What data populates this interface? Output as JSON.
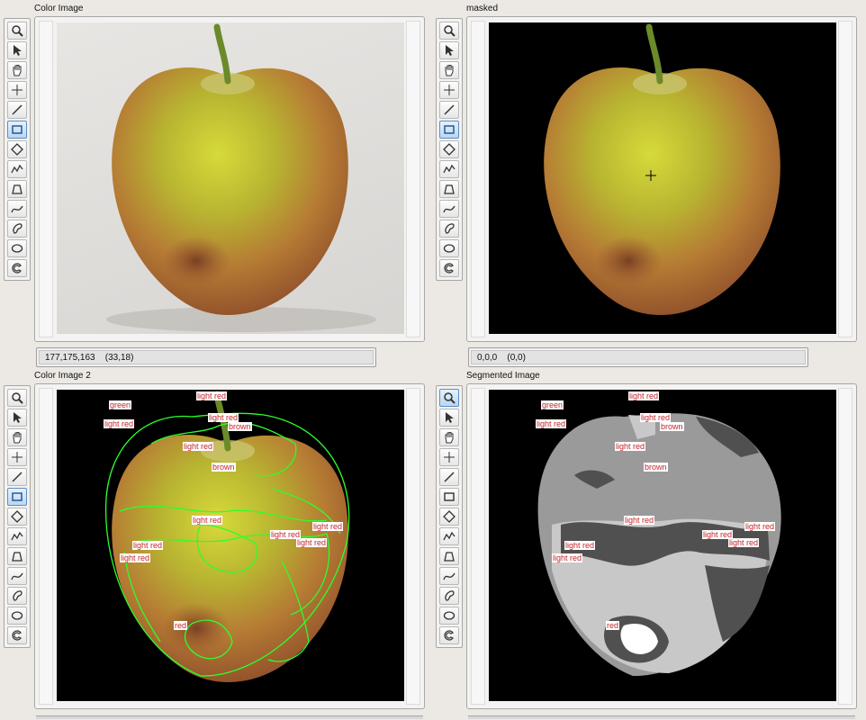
{
  "panels": {
    "top_left": {
      "title": "Color Image",
      "status_value": "177,175,163",
      "status_coord": "(33,18)"
    },
    "top_right": {
      "title": "masked",
      "status_value": "0,0,0",
      "status_coord": "(0,0)"
    },
    "bottom_left": {
      "title": "Color Image 2"
    },
    "bottom_right": {
      "title": "Segmented Image"
    }
  },
  "toolbar": {
    "tools": [
      "zoom-icon",
      "pointer-icon",
      "pan-hand-icon",
      "crosshair-icon",
      "line-icon",
      "rectangle-icon",
      "rotated-rect-icon",
      "polyline-icon",
      "annulus-icon",
      "freehand-icon",
      "closed-freehand-icon",
      "oval-icon",
      "broken-annulus-icon"
    ]
  },
  "labels": [
    {
      "text": "green"
    },
    {
      "text": "light red"
    },
    {
      "text": "light red"
    },
    {
      "text": "light red"
    },
    {
      "text": "brown"
    },
    {
      "text": "light red"
    },
    {
      "text": "brown"
    },
    {
      "text": "light red"
    },
    {
      "text": "light red"
    },
    {
      "text": "light red"
    },
    {
      "text": "light red"
    },
    {
      "text": "light red"
    },
    {
      "text": "light red"
    },
    {
      "text": "red"
    }
  ],
  "colors": {
    "apple_green": "#a9b02b",
    "apple_red": "#b5632f",
    "contour": "#2bff2b",
    "label_text": "#c0262b",
    "segment_dark": "#505050",
    "segment_mid": "#9a9a9a",
    "segment_light": "#c8c8c8"
  }
}
